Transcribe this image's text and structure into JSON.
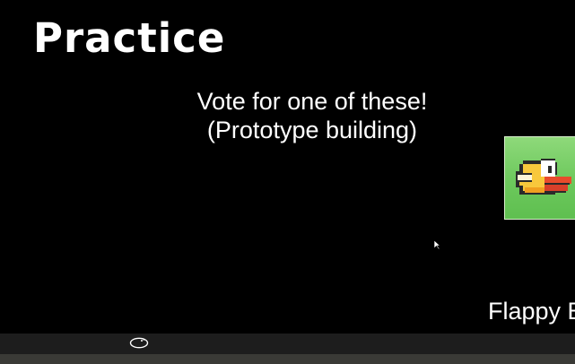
{
  "slide": {
    "title": "Practice",
    "subtitle_line1": "Vote for one of these!",
    "subtitle_line2": "(Prototype building)"
  },
  "game_option": {
    "label": "Flappy B",
    "icon": "flappy-bird-icon",
    "tile_color": "#6cc85c"
  },
  "taskbar": {
    "tray_icon": "cloud-icon"
  }
}
